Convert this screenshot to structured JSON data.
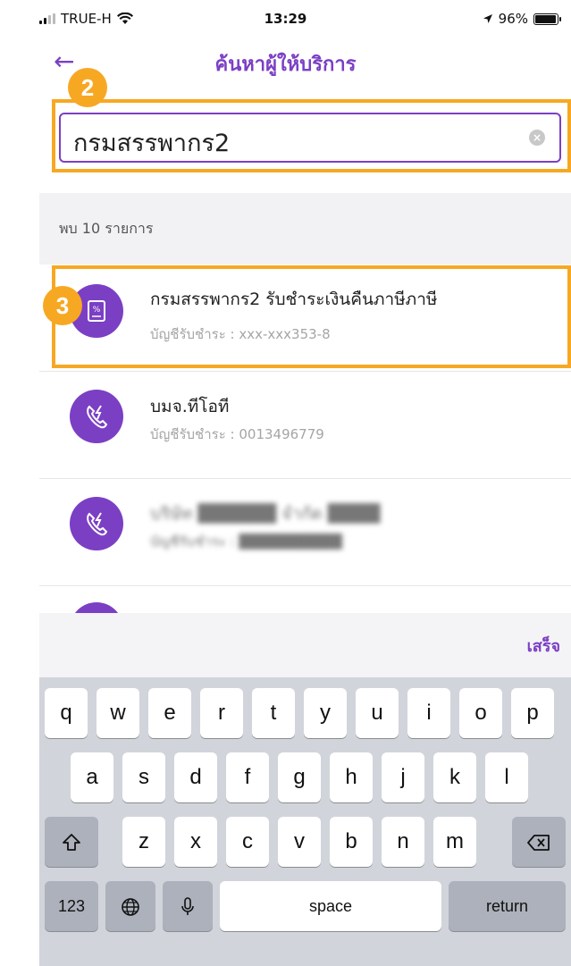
{
  "status": {
    "carrier": "TRUE-H",
    "time": "13:29",
    "battery": "96%",
    "battery_level": 0.96,
    "signal_bars": 2
  },
  "header": {
    "back_icon": "arrow-left-icon",
    "title": "ค้นหาผู้ให้บริการ"
  },
  "search": {
    "value": "กรมสรรพากร2",
    "clear_icon": "clear-circle-icon"
  },
  "annotations": {
    "step2": "2",
    "step3": "3",
    "highlight_color": "#f7a823"
  },
  "results": {
    "count_label": "พบ 10 รายการ",
    "items": [
      {
        "name": "กรมสรรพากร2 รับชำระเงินคืนภาษีภาษี",
        "account": "บัญชีรับชำระ : xxx-xxx353-8",
        "icon": "receipt-icon"
      },
      {
        "name": "บมจ.ทีโอที",
        "account": "บัญชีรับชำระ : 0013496779",
        "icon": "phone-lightning-icon"
      },
      {
        "name": "บริษัท ██████ จำกัด ████",
        "account": "บัญชีรับชำระ : ██████████",
        "icon": "phone-lightning-icon"
      }
    ]
  },
  "keyboard": {
    "done_label": "เสร็จ",
    "row1": [
      "q",
      "w",
      "e",
      "r",
      "t",
      "y",
      "u",
      "i",
      "o",
      "p"
    ],
    "row2": [
      "a",
      "s",
      "d",
      "f",
      "g",
      "h",
      "j",
      "k",
      "l"
    ],
    "row3": [
      "z",
      "x",
      "c",
      "v",
      "b",
      "n",
      "m"
    ],
    "num_label": "123",
    "space_label": "space",
    "return_label": "return"
  },
  "colors": {
    "accent": "#7b3fc4",
    "highlight": "#f7a823"
  }
}
